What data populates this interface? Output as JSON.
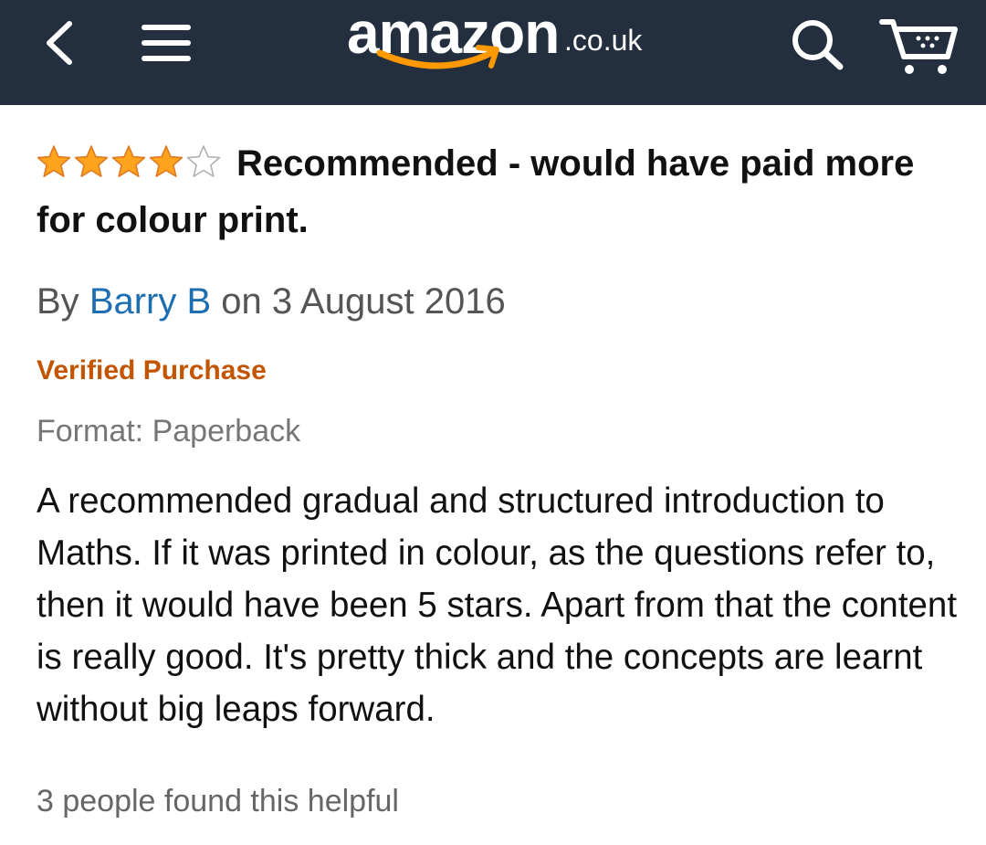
{
  "header": {
    "logo_word": "amazon",
    "logo_tld": ".co.uk",
    "brand_background": "#232f3e",
    "smile_color": "#f90",
    "icons": [
      "back-icon",
      "menu-icon",
      "search-icon",
      "cart-icon"
    ]
  },
  "review": {
    "rating": 4,
    "rating_max": 5,
    "star_color": "#ffa41c",
    "title": "Recommended - would have paid more for colour print.",
    "by_label": "By",
    "author": "Barry B",
    "date": "on 3 August 2016",
    "verified": "Verified Purchase",
    "format": "Format: Paperback",
    "body": "A recommended gradual and structured introduction to Maths. If it was printed in colour, as the questions refer to, then it would have been 5 stars. Apart from that the content is really good. It's pretty thick and the concepts are learnt without big leaps forward.",
    "helpful": "3 people found this helpful"
  }
}
